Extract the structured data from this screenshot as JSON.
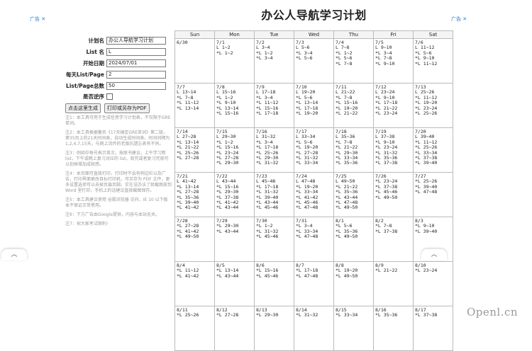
{
  "ads": {
    "left": "广告 ✕",
    "right": "广告 ✕"
  },
  "title": "办公人导航学习计划",
  "form": {
    "plan_name_label": "计划名",
    "plan_name_value": "办公人导航学习计划",
    "list_name_label": "List 名",
    "list_name_value": "L",
    "start_date_label": "开始日期",
    "start_date_value": "2024/07/01",
    "per_day_label": "每天List/Page",
    "per_day_value": "2",
    "total_label": "List/Page总数",
    "total_value": "50",
    "reverse_label": "是否逆序"
  },
  "buttons": {
    "generate": "点击这里生成",
    "print": "打印或另存为PDF"
  },
  "notes": [
    "注1：本工具可用于生成任意学习计划表，不仅限于GRE单词。",
    "注2：本工具根据著名《17天搞定GRE单词》第二版，第35页上的21天时间表，自动生成时间表。时间间隔为1,2,4,7,15天。与网上流传的老版抗遗忘表有不同。",
    "注3：例如中每号表示首次，按原书建议，上午学习新 list，下午或晚上复习对应的 list，背完或者复习完就可以划掉增加成就感。",
    "注4：本页面可直接打印，打印时不会有侧边栏以及广告，打印界面更改目标打印机，可另存为 PDF 文件，更多设置选项可以去掉页眉页脚。实在没办法了就截图放到 Word 里打印，手机上的话建议直接截图保存。",
    "注5：本工具建议使用 谷歌浏览器 访问，IE 10 以下版本不保证正常使用。",
    "注6：下方广告由Google提供，内容与本站无关。",
    "注7：祝大家考试顺利!"
  ],
  "calendar": {
    "days": [
      "Sun",
      "Mon",
      "Tue",
      "Wed",
      "Thu",
      "Fri",
      "Sat"
    ],
    "weeks": [
      [
        {
          "date": "6/30",
          "entries": []
        },
        {
          "date": "7/1",
          "entries": [
            "  L 1~2",
            "*L 1~2"
          ]
        },
        {
          "date": "7/2",
          "entries": [
            "  L 3~4",
            "*L 1~2",
            "*L 3~4"
          ]
        },
        {
          "date": "7/3",
          "entries": [
            "  L 5~6",
            "*L 3~4",
            "*L 5~6"
          ]
        },
        {
          "date": "7/4",
          "entries": [
            "  L 7~8",
            "*L 1~2",
            "*L 5~6",
            "*L 7~8"
          ]
        },
        {
          "date": "7/5",
          "entries": [
            "  L 9~10",
            "*L 3~4",
            "*L 7~8",
            "*L 9~10"
          ]
        },
        {
          "date": "7/6",
          "entries": [
            "  L 11~12",
            "*L 5~6",
            "*L 9~10",
            "*L 11~12"
          ]
        }
      ],
      [
        {
          "date": "7/7",
          "entries": [
            "  L 13~14",
            "*L 7~8",
            "*L 11~12",
            "*L 13~14"
          ]
        },
        {
          "date": "7/8",
          "entries": [
            "  L 15~16",
            "*L 1~2",
            "*L 9~10",
            "*L 13~14",
            "*L 15~16"
          ]
        },
        {
          "date": "7/9",
          "entries": [
            "  L 17~18",
            "*L 3~4",
            "*L 11~12",
            "*L 15~16",
            "*L 17~18"
          ]
        },
        {
          "date": "7/10",
          "entries": [
            "  L 19~20",
            "*L 5~6",
            "*L 13~14",
            "*L 17~18",
            "*L 19~20"
          ]
        },
        {
          "date": "7/11",
          "entries": [
            "  L 21~22",
            "*L 7~8",
            "*L 15~16",
            "*L 19~20",
            "*L 21~22"
          ]
        },
        {
          "date": "7/12",
          "entries": [
            "  L 23~24",
            "*L 9~10",
            "*L 17~18",
            "*L 21~22",
            "*L 23~24"
          ]
        },
        {
          "date": "7/13",
          "entries": [
            "  L 25~26",
            "*L 11~12",
            "*L 19~20",
            "*L 23~24",
            "*L 25~26"
          ]
        }
      ],
      [
        {
          "date": "7/14",
          "entries": [
            "  L 27~28",
            "*L 13~14",
            "*L 21~22",
            "*L 25~26",
            "*L 27~28"
          ]
        },
        {
          "date": "7/15",
          "entries": [
            "  L 29~30",
            "*L 1~2",
            "*L 15~16",
            "*L 23~24",
            "*L 27~28",
            "*L 29~30"
          ]
        },
        {
          "date": "7/16",
          "entries": [
            "  L 31~32",
            "*L 3~4",
            "*L 17~18",
            "*L 25~26",
            "*L 29~30",
            "*L 31~32"
          ]
        },
        {
          "date": "7/17",
          "entries": [
            "  L 33~34",
            "*L 5~6",
            "*L 19~20",
            "*L 27~28",
            "*L 31~32",
            "*L 33~34"
          ]
        },
        {
          "date": "7/18",
          "entries": [
            "  L 35~36",
            "*L 7~8",
            "*L 21~22",
            "*L 29~30",
            "*L 33~34",
            "*L 35~36"
          ]
        },
        {
          "date": "7/19",
          "entries": [
            "  L 37~38",
            "*L 9~10",
            "*L 23~24",
            "*L 31~32",
            "*L 35~36",
            "*L 37~38"
          ]
        },
        {
          "date": "7/20",
          "entries": [
            "  L 39~40",
            "*L 11~12",
            "*L 25~26",
            "*L 33~34",
            "*L 37~38",
            "*L 39~40"
          ]
        }
      ],
      [
        {
          "date": "7/21",
          "entries": [
            "  L 41~42",
            "*L 13~14",
            "*L 27~28",
            "*L 35~36",
            "*L 39~40",
            "*L 41~42"
          ]
        },
        {
          "date": "7/22",
          "entries": [
            "  L 43~44",
            "*L 15~16",
            "*L 29~30",
            "*L 37~38",
            "*L 41~42",
            "*L 43~44"
          ]
        },
        {
          "date": "7/23",
          "entries": [
            "  L 45~46",
            "*L 17~18",
            "*L 31~32",
            "*L 39~40",
            "*L 43~44",
            "*L 45~46"
          ]
        },
        {
          "date": "7/24",
          "entries": [
            "  L 47~48",
            "*L 19~20",
            "*L 33~34",
            "*L 41~42",
            "*L 45~46",
            "*L 47~48"
          ]
        },
        {
          "date": "7/25",
          "entries": [
            "  L 49~50",
            "*L 21~22",
            "*L 35~36",
            "*L 43~44",
            "*L 47~48",
            "*L 49~50"
          ]
        },
        {
          "date": "7/26",
          "entries": [
            "*L 23~24",
            "*L 37~38",
            "*L 45~46",
            "*L 49~50"
          ]
        },
        {
          "date": "7/27",
          "entries": [
            "*L 25~26",
            "*L 39~40",
            "*L 47~48"
          ]
        }
      ],
      [
        {
          "date": "7/28",
          "entries": [
            "*L 27~28",
            "*L 41~42",
            "*L 49~50"
          ]
        },
        {
          "date": "7/29",
          "entries": [
            "*L 29~30",
            "*L 43~44"
          ]
        },
        {
          "date": "7/30",
          "entries": [
            "*L 1~2",
            "*L 31~32",
            "*L 45~46"
          ]
        },
        {
          "date": "7/31",
          "entries": [
            "*L 3~4",
            "*L 33~34",
            "*L 47~48"
          ]
        },
        {
          "date": "8/1",
          "entries": [
            "*L 5~6",
            "*L 35~36",
            "*L 49~50"
          ]
        },
        {
          "date": "8/2",
          "entries": [
            "*L 7~8",
            "*L 37~38"
          ]
        },
        {
          "date": "8/3",
          "entries": [
            "*L 9~10",
            "*L 39~40"
          ]
        }
      ],
      [
        {
          "date": "8/4",
          "entries": [
            "*L 11~12",
            "*L 41~42"
          ]
        },
        {
          "date": "8/5",
          "entries": [
            "*L 13~14",
            "*L 43~44"
          ]
        },
        {
          "date": "8/6",
          "entries": [
            "*L 15~16",
            "*L 45~46"
          ]
        },
        {
          "date": "8/7",
          "entries": [
            "*L 17~18",
            "*L 47~48"
          ]
        },
        {
          "date": "8/8",
          "entries": [
            "*L 19~20",
            "*L 49~50"
          ]
        },
        {
          "date": "8/9",
          "entries": [
            "*L 21~22"
          ]
        },
        {
          "date": "8/10",
          "entries": [
            "*L 23~24"
          ]
        }
      ],
      [
        {
          "date": "8/11",
          "entries": [
            "*L 25~26"
          ]
        },
        {
          "date": "8/12",
          "entries": [
            "*L 27~28"
          ]
        },
        {
          "date": "8/13",
          "entries": [
            "*L 29~30"
          ]
        },
        {
          "date": "8/14",
          "entries": [
            "*L 31~32"
          ]
        },
        {
          "date": "8/15",
          "entries": [
            "*L 33~34"
          ]
        },
        {
          "date": "8/16",
          "entries": [
            "*L 35~36"
          ]
        },
        {
          "date": "8/17",
          "entries": [
            "*L 37~38"
          ]
        }
      ]
    ]
  },
  "collapse_glyph": "︿",
  "watermark": "Openl.cn"
}
